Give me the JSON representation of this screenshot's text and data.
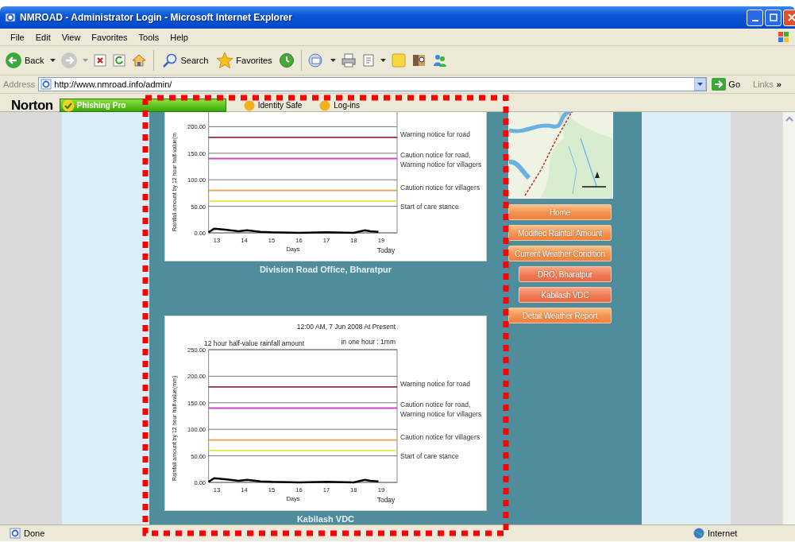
{
  "window": {
    "title": "NMROAD - Administrator Login - Microsoft Internet Explorer"
  },
  "menu": [
    "File",
    "Edit",
    "View",
    "Favorites",
    "Tools",
    "Help"
  ],
  "toolbar": {
    "back": "Back",
    "search": "Search",
    "favorites": "Favorites"
  },
  "address": {
    "label": "Address",
    "url": "http://www.nmroad.info/admin/",
    "go": "Go",
    "links": "Links",
    "more": "»"
  },
  "norton": {
    "logo": "Norton",
    "phishing": "Phishing Pro",
    "identity": "Identity Safe",
    "logins": "Log-ins"
  },
  "charts": [
    {
      "caption": "Division Road Office, Bharatpur",
      "today_label": "Today",
      "chart_data": {
        "type": "line",
        "xlabel": "Days",
        "ylabel": "Rainfall amount by 12 hour half-value(m",
        "x": [
          12.7,
          12.9,
          13.3,
          13.8,
          14.1,
          14.6,
          15,
          16,
          17,
          18,
          18.4,
          18.6,
          18.9,
          19.58
        ],
        "series": [
          {
            "color": "#000000",
            "values": [
              1,
              8,
              6,
              3,
              5,
              2,
              1,
              0,
              1,
              0,
              5,
              3,
              2,
              null
            ]
          },
          {
            "name": "Warning notice for road",
            "color": "#8b2a5a",
            "values": [
              180,
              180,
              180,
              180,
              180,
              180,
              180,
              180,
              180,
              180,
              180,
              180,
              180,
              180
            ]
          },
          {
            "name": "Caution notice for road, Warning notice for villagers",
            "color": "#cc44cc",
            "values": [
              140,
              140,
              140,
              140,
              140,
              140,
              140,
              140,
              140,
              140,
              140,
              140,
              140,
              140
            ]
          },
          {
            "name": "Caution notice for villagers",
            "color": "#e8a040",
            "values": [
              80,
              80,
              80,
              80,
              80,
              80,
              80,
              80,
              80,
              80,
              80,
              80,
              80,
              80
            ]
          },
          {
            "name": "Start of care stance",
            "color": "#e6e640",
            "values": [
              60,
              60,
              60,
              60,
              60,
              60,
              60,
              60,
              60,
              60,
              60,
              60,
              60,
              60
            ]
          }
        ],
        "xlim": [
          12.7,
          19.58
        ],
        "ylim": [
          0,
          250
        ],
        "grid": true,
        "xticks": [
          13,
          14,
          15,
          16,
          17,
          18,
          19
        ],
        "yticks": [
          {
            "value": 0,
            "label": "0.00"
          },
          {
            "value": 50,
            "label": "50.00"
          },
          {
            "value": 100,
            "label": "100.00"
          },
          {
            "value": 150,
            "label": "150.00"
          },
          {
            "value": 200,
            "label": "200.00"
          }
        ]
      }
    },
    {
      "caption": "Kabilash VDC",
      "timestamp": "12:00 AM, 7 Jun 2008 At Present",
      "rate": "in one hour : 1mm",
      "today_label": "Today",
      "chart_data": {
        "type": "line",
        "title": "12 hour half-value rainfall amount",
        "xlabel": "Days",
        "ylabel": "Rainfall amount by 12 hour half-value(mm)",
        "x": [
          12.7,
          12.9,
          13.3,
          13.8,
          14.1,
          14.6,
          15,
          16,
          17,
          18,
          18.4,
          18.6,
          18.9,
          19.58
        ],
        "series": [
          {
            "color": "#000000",
            "values": [
              1,
              8,
              6,
              3,
              5,
              2,
              1,
              0,
              1,
              0,
              5,
              3,
              2,
              null
            ]
          },
          {
            "name": "Warning notice for road",
            "color": "#8b2a5a",
            "values": [
              180,
              180,
              180,
              180,
              180,
              180,
              180,
              180,
              180,
              180,
              180,
              180,
              180,
              180
            ]
          },
          {
            "name": "Caution notice for road, Warning notice for villagers",
            "color": "#cc44cc",
            "values": [
              140,
              140,
              140,
              140,
              140,
              140,
              140,
              140,
              140,
              140,
              140,
              140,
              140,
              140
            ]
          },
          {
            "name": "Caution notice for villagers",
            "color": "#e8a040",
            "values": [
              80,
              80,
              80,
              80,
              80,
              80,
              80,
              80,
              80,
              80,
              80,
              80,
              80,
              80
            ]
          },
          {
            "name": "Start of care stance",
            "color": "#e6e640",
            "values": [
              60,
              60,
              60,
              60,
              60,
              60,
              60,
              60,
              60,
              60,
              60,
              60,
              60,
              60
            ]
          }
        ],
        "xlim": [
          12.7,
          19.58
        ],
        "ylim": [
          0,
          250
        ],
        "grid": true,
        "xticks": [
          13,
          14,
          15,
          16,
          17,
          18,
          19
        ],
        "yticks": [
          {
            "value": 0,
            "label": "0.00"
          },
          {
            "value": 50,
            "label": "50.00"
          },
          {
            "value": 100,
            "label": "100.00"
          },
          {
            "value": 150,
            "label": "150.00"
          },
          {
            "value": 200,
            "label": "200.00"
          },
          {
            "value": 250,
            "label": "250.00"
          }
        ]
      }
    }
  ],
  "nav": [
    {
      "label": "Home",
      "kind": "main"
    },
    {
      "label": "Modified Rainfall Amount",
      "kind": "main"
    },
    {
      "label": "Current Weather Condition",
      "kind": "main"
    },
    {
      "label": "DRO, Bharatpur",
      "kind": "sub"
    },
    {
      "label": "Kabilash VDC",
      "kind": "sub"
    },
    {
      "label": "Detail Weather Report",
      "kind": "main"
    }
  ],
  "status_bar": {
    "text": "Done",
    "zone": "Internet"
  }
}
